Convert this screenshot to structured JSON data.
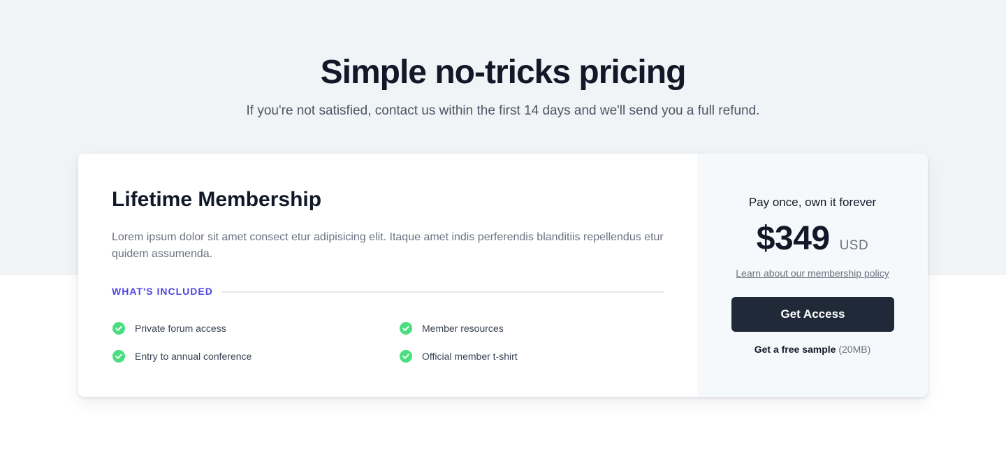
{
  "hero": {
    "title": "Simple no-tricks pricing",
    "subtitle": "If you're not satisfied, contact us within the first 14 days and we'll send you a full refund."
  },
  "plan": {
    "title": "Lifetime Membership",
    "description": "Lorem ipsum dolor sit amet consect etur adipisicing elit. Itaque amet indis perferendis blanditiis repellendus etur quidem assumenda.",
    "included_label": "WHAT'S INCLUDED",
    "features": [
      {
        "label": "Private forum access",
        "icon": "check-circle-icon"
      },
      {
        "label": "Member resources",
        "icon": "check-circle-icon"
      },
      {
        "label": "Entry to annual conference",
        "icon": "check-circle-icon"
      },
      {
        "label": "Official member t-shirt",
        "icon": "check-circle-icon"
      }
    ]
  },
  "pricing": {
    "tagline": "Pay once, own it forever",
    "amount": "$349",
    "currency": "USD",
    "policy_link": "Learn about our membership policy",
    "cta_label": "Get Access",
    "sample_link": "Get a free sample",
    "sample_size": "(20MB)"
  },
  "colors": {
    "accent": "#4f46e5",
    "check": "#4ade80",
    "button": "#1f2937",
    "hero_background": "#f1f4f7",
    "panel_background": "#f6f9fc"
  }
}
